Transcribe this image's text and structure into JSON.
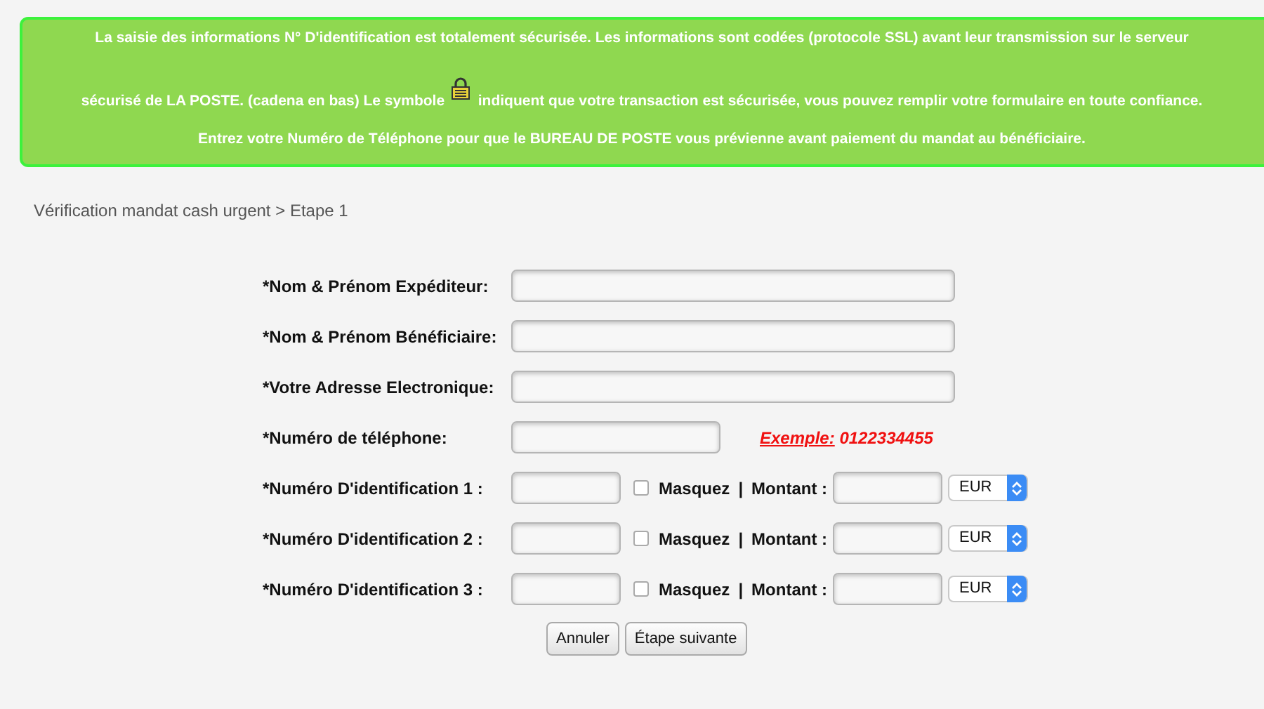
{
  "notice": {
    "line_1": "La saisie des informations N° D'identification est totalement sécurisée. Les informations sont codées (protocole SSL) avant leur transmission sur le serveur",
    "line_2_before_icon": "sécurisé de LA POSTE. (cadena en bas) Le symbole",
    "line_2_after_icon": "indiquent que votre transaction est sécurisée, vous pouvez remplir votre formulaire en toute confiance.",
    "line_3": "Entrez votre Numéro de Téléphone pour que le BUREAU DE POSTE vous prévienne avant paiement du mandat au bénéficiaire."
  },
  "breadcrumb": "Vérification mandat cash urgent > Etape 1",
  "fields": [
    {
      "kind": "text",
      "label": "*Nom & Prénom Expéditeur:"
    },
    {
      "kind": "text",
      "label": "*Nom & Prénom Bénéficiaire:"
    },
    {
      "kind": "text",
      "label": "*Votre Adresse Electronique:"
    },
    {
      "kind": "phone",
      "label": "*Numéro de téléphone:",
      "example_label": "Exemple:",
      "example_value": " 0122334455"
    },
    {
      "kind": "id",
      "label": "*Numéro D'identification 1 :",
      "mask_label": "Masquez",
      "checked": false,
      "separator": "|",
      "amount_label": "Montant :",
      "currency": "EUR"
    },
    {
      "kind": "id",
      "label": "*Numéro D'identification 2 :",
      "mask_label": "Masquez",
      "checked": false,
      "separator": "|",
      "amount_label": "Montant :",
      "currency": "EUR"
    },
    {
      "kind": "id",
      "label": "*Numéro D'identification 3 :",
      "mask_label": "Masquez",
      "checked": false,
      "separator": "|",
      "amount_label": "Montant :",
      "currency": "EUR"
    }
  ],
  "buttons": [
    "Annuler",
    "Étape suivante"
  ]
}
